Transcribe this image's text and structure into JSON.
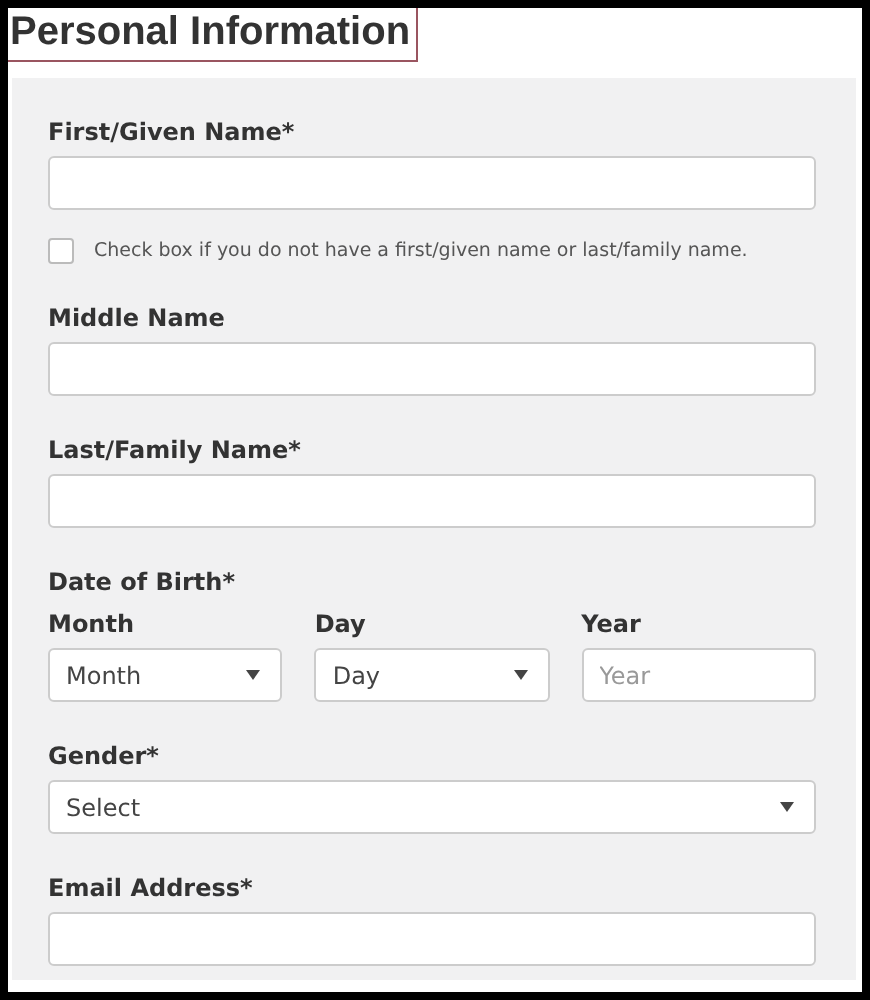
{
  "title": "Personal Information",
  "first_name": {
    "label": "First/Given Name*"
  },
  "no_name_checkbox": {
    "label": "Check box if you do not have a first/given name or last/family name.",
    "checked": false
  },
  "middle_name": {
    "label": "Middle Name"
  },
  "last_name": {
    "label": "Last/Family Name*"
  },
  "date_of_birth": {
    "label": "Date of Birth*",
    "parts": [
      {
        "kind": "select",
        "label": "Month",
        "value": "Month"
      },
      {
        "kind": "select",
        "label": "Day",
        "value": "Day"
      },
      {
        "kind": "input",
        "label": "Year",
        "placeholder": "Year"
      }
    ]
  },
  "gender": {
    "label": "Gender*",
    "value": "Select"
  },
  "email": {
    "label": "Email Address*"
  }
}
